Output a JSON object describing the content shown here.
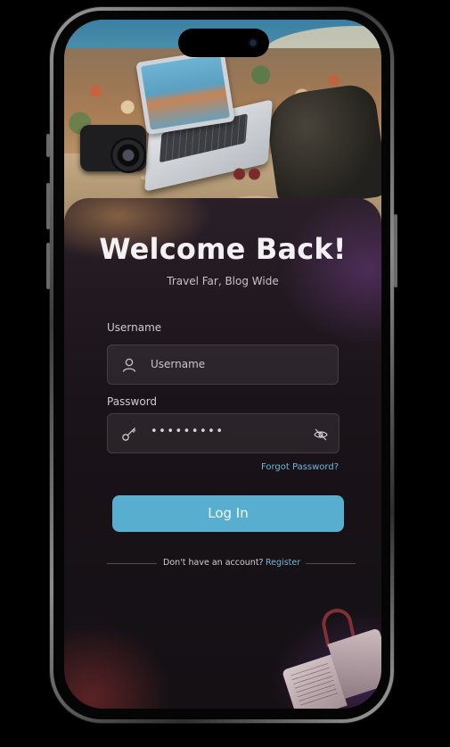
{
  "login": {
    "title": "Welcome Back!",
    "subtitle": "Travel Far, Blog Wide",
    "username": {
      "label": "Username",
      "placeholder": "Username",
      "icon": "user-icon"
    },
    "password": {
      "label": "Password",
      "value": "•••••••••",
      "icon": "key-icon",
      "toggle_icon": "eye-off-icon"
    },
    "forgot_label": "Forgot Password?",
    "login_button": "Log In",
    "register_prompt": "Don't have an account?",
    "register_link": "Register"
  },
  "colors": {
    "accent": "#57aece",
    "link": "#6fb8d9",
    "title": "#f4f1f5",
    "card_bg": "#1a1319"
  }
}
